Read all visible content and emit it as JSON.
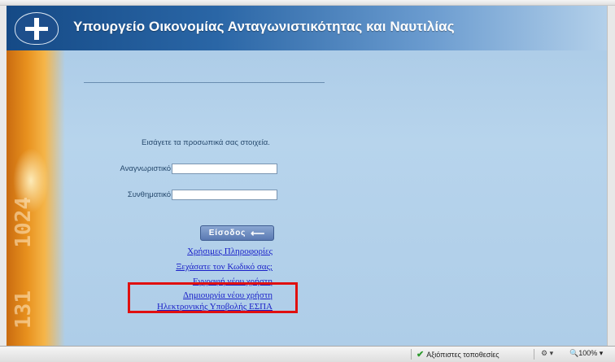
{
  "header": {
    "title": "Υπουργείο Οικονομίας Ανταγωνιστικότητας και Ναυτιλίας"
  },
  "decor": {
    "numbers": [
      "1024",
      "131"
    ]
  },
  "login": {
    "prompt": "Εισάγετε τα προσωπικά σας στοιχεία.",
    "username_label": "Αναγνωριστικό",
    "password_label": "Συνθηματικό",
    "username_value": "",
    "password_value": "",
    "button_label": "Είσοδος"
  },
  "links": [
    "Χρήσιμες Πληροφορίες",
    "Ξεχάσατε τον Κωδικό σας;",
    "Εγγραφή νέου χρήστη",
    "Δημιουργία νέου χρήστη",
    "Ηλεκτρονικής Υποβολής ΕΣΠΑ"
  ],
  "statusbar": {
    "zone": "Αξιόπιστες τοποθεσίες",
    "zoom": "100%"
  },
  "colors": {
    "banner": "#1d4f8c",
    "page_bg": "#b0cfea",
    "link": "#1a20c8",
    "highlight": "#e01010",
    "accent_orange": "#e8911e"
  }
}
